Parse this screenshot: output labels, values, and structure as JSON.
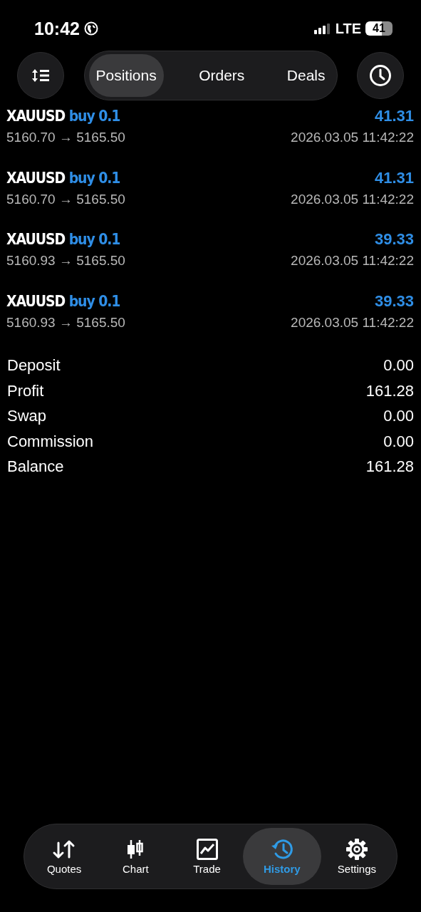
{
  "status_bar": {
    "time": "10:42",
    "network": "LTE",
    "battery": "41"
  },
  "tabs": [
    {
      "label": "Positions",
      "selected": true
    },
    {
      "label": "Orders",
      "selected": false
    },
    {
      "label": "Deals",
      "selected": false
    }
  ],
  "deals": [
    {
      "symbol": "XAUUSD",
      "side": "buy 0.1",
      "profit": "41.31",
      "prices": "5160.70 → 5165.50",
      "time": "2026.03.05 11:42:22"
    },
    {
      "symbol": "XAUUSD",
      "side": "buy 0.1",
      "profit": "41.31",
      "prices": "5160.70 → 5165.50",
      "time": "2026.03.05 11:42:22"
    },
    {
      "symbol": "XAUUSD",
      "side": "buy 0.1",
      "profit": "39.33",
      "prices": "5160.93 → 5165.50",
      "time": "2026.03.05 11:42:22"
    },
    {
      "symbol": "XAUUSD",
      "side": "buy 0.1",
      "profit": "39.33",
      "prices": "5160.93 → 5165.50",
      "time": "2026.03.05 11:42:22"
    }
  ],
  "summary": [
    {
      "label": "Deposit",
      "value": "0.00"
    },
    {
      "label": "Profit",
      "value": "161.28"
    },
    {
      "label": "Swap",
      "value": "0.00"
    },
    {
      "label": "Commission",
      "value": "0.00"
    },
    {
      "label": "Balance",
      "value": "161.28"
    }
  ],
  "nav": [
    {
      "kind": "quotes",
      "label": "Quotes",
      "selected": false
    },
    {
      "kind": "chart",
      "label": "Chart",
      "selected": false
    },
    {
      "kind": "trade",
      "label": "Trade",
      "selected": false
    },
    {
      "kind": "history",
      "label": "History",
      "selected": true
    },
    {
      "kind": "settings",
      "label": "Settings",
      "selected": false
    }
  ]
}
